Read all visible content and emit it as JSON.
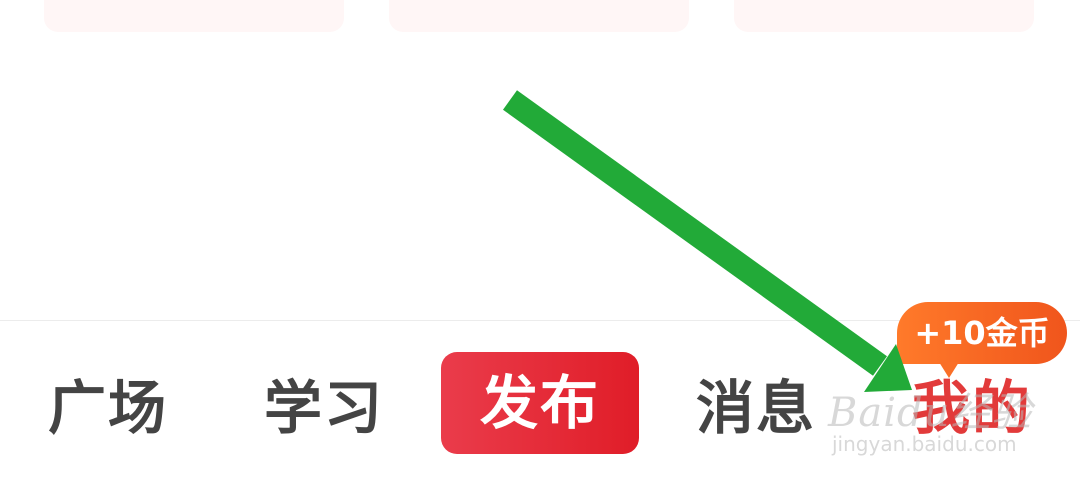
{
  "tabbar": {
    "items": [
      {
        "label": "广场"
      },
      {
        "label": "学习"
      },
      {
        "label": "发布"
      },
      {
        "label": "消息"
      },
      {
        "label": "我的"
      }
    ],
    "coin_badge": "+10金币"
  },
  "colors": {
    "publish_start": "#ea3c4b",
    "publish_end": "#e01d28",
    "badge": "#f0551c",
    "active_tab": "#e23a3a",
    "arrow": "#22aa38"
  },
  "watermark": {
    "logo": "Baidu经验",
    "url": "jingyan.baidu.com"
  }
}
